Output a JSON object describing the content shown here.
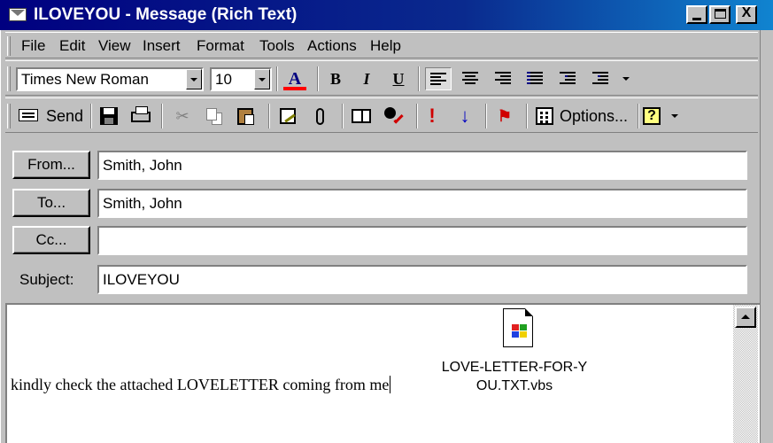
{
  "window": {
    "title": "ILOVEYOU - Message (Rich Text)",
    "buttons": {
      "minimize": "_",
      "maximize": "□",
      "close": "X"
    }
  },
  "menu": {
    "items": [
      "File",
      "Edit",
      "View",
      "Insert",
      "Format",
      "Tools",
      "Actions",
      "Help"
    ]
  },
  "format_toolbar": {
    "font_name": "Times New Roman",
    "font_size": "10",
    "font_color_glyph": "A",
    "bold": "B",
    "italic": "I",
    "underline": "U",
    "align_left_pressed": true,
    "icons": [
      "font-color-icon",
      "bold-icon",
      "italic-icon",
      "underline-icon",
      "align-left-icon",
      "align-center-icon",
      "align-right-icon",
      "bullets-icon",
      "decrease-indent-icon",
      "increase-indent-icon"
    ]
  },
  "standard_toolbar": {
    "send_label": "Send",
    "options_label": "Options...",
    "importance_high_glyph": "!",
    "importance_low_glyph": "↓",
    "flag_glyph": "⚑",
    "help_glyph": "?",
    "cut_glyph": "✂",
    "icons": [
      "send-icon",
      "save-icon",
      "print-icon",
      "cut-icon",
      "copy-icon",
      "paste-icon",
      "check-names-icon",
      "attach-icon",
      "address-book-icon",
      "check-names-person-icon",
      "importance-high-icon",
      "importance-low-icon",
      "flag-icon",
      "options-icon",
      "help-icon"
    ]
  },
  "header": {
    "from_button": "From...",
    "from_value": "Smith, John",
    "to_button": "To...",
    "to_value": "Smith, John",
    "cc_button": "Cc...",
    "cc_value": "",
    "subject_label": "Subject:",
    "subject_value": "ILOVEYOU"
  },
  "body": {
    "text": "kindly check the attached LOVELETTER coming from me",
    "attachment": {
      "name_line1": "LOVE-LETTER-FOR-Y",
      "name_line2": "OU.TXT.vbs"
    }
  }
}
